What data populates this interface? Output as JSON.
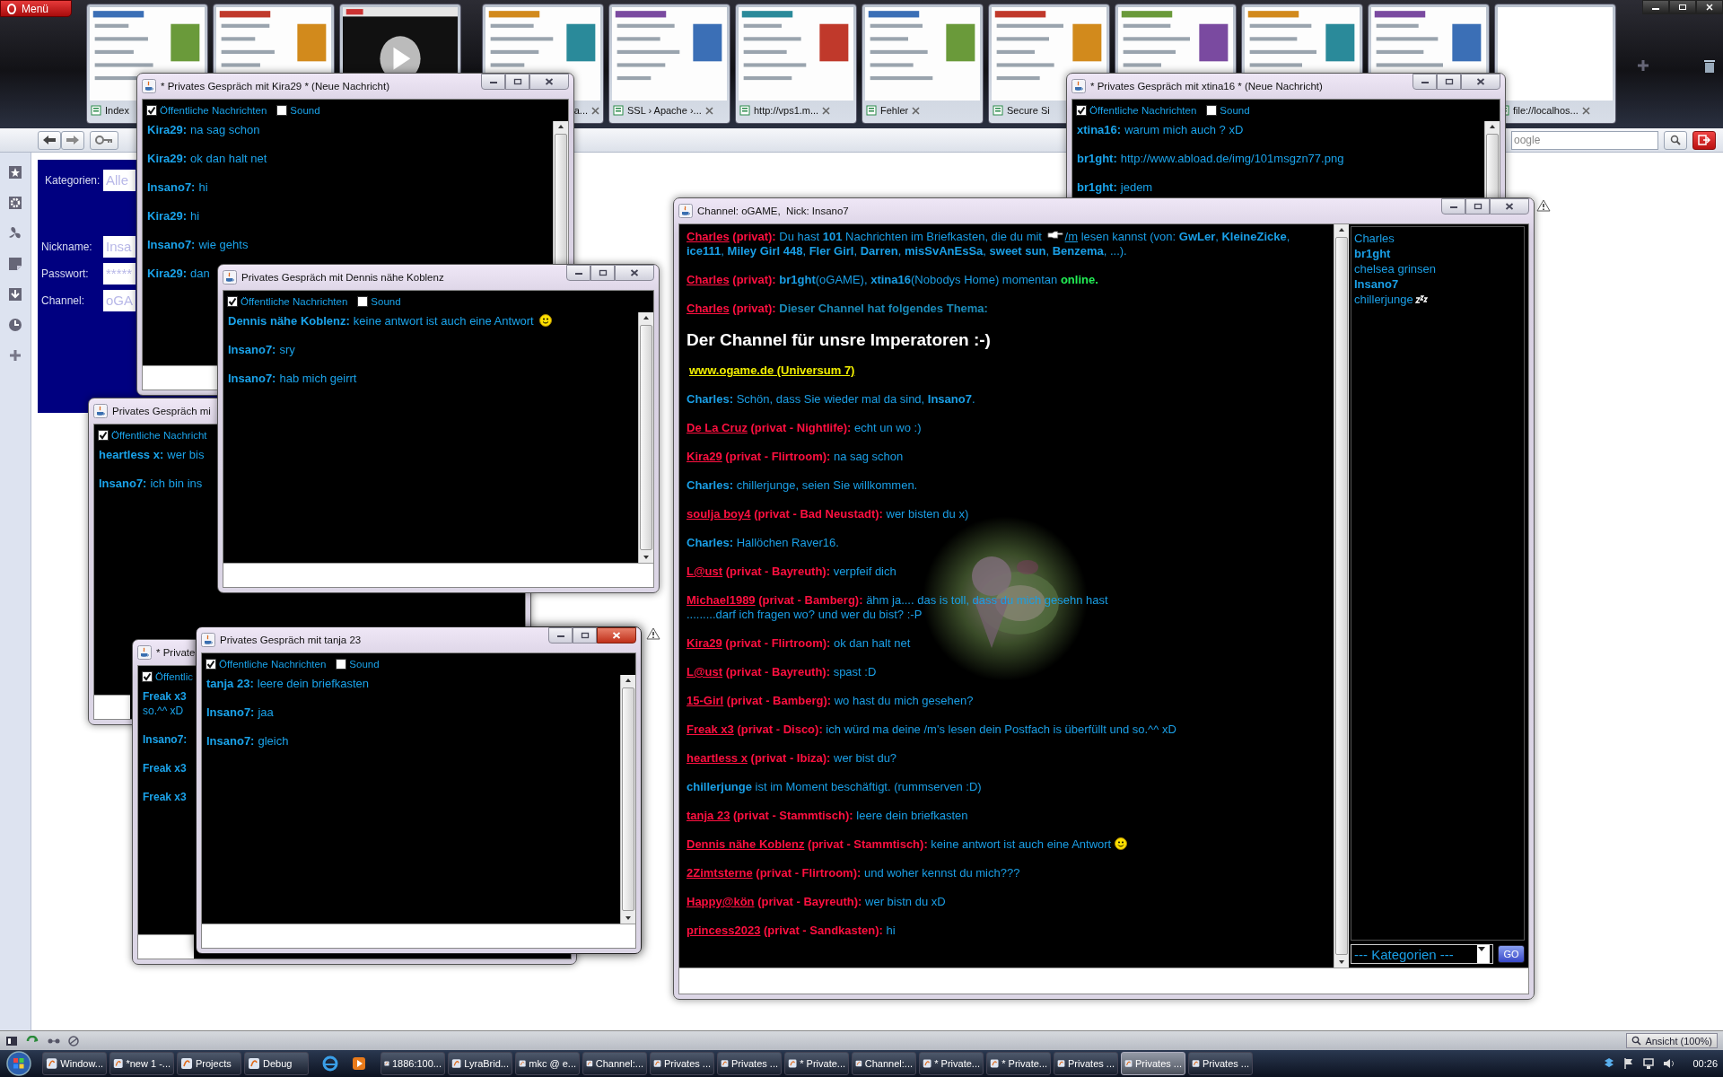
{
  "browser": {
    "menu": "Menü",
    "tabs": [
      {
        "kind": "page",
        "label": "Index",
        "cut": false,
        "close_button": false
      },
      {
        "kind": "page"
      },
      {
        "kind": "video"
      },
      {
        "kind": "page",
        "label": "a...",
        "cut": true,
        "close_button": true
      },
      {
        "kind": "page",
        "label": "SSL › Apache ›...",
        "cut": false,
        "close_button": true
      },
      {
        "kind": "page",
        "label": "http://vps1.m...",
        "cut": false,
        "close_button": true
      },
      {
        "kind": "page",
        "label": "Fehler",
        "cut": false,
        "close_button": true
      },
      {
        "kind": "page",
        "label": "Secure Si",
        "cut": false,
        "close_button": false
      },
      {
        "kind": "page"
      },
      {
        "kind": "page"
      },
      {
        "kind": "page"
      },
      {
        "kind": "blank",
        "label": "file://localhos...",
        "cut": false,
        "close_button": true
      }
    ],
    "search": {
      "placeholder": "oogle"
    }
  },
  "login_panel": {
    "rows": [
      {
        "label": "Kategorien:",
        "value": "Alle"
      },
      {
        "label": "Nickname:",
        "value": "Insa"
      },
      {
        "label": "Passwort:",
        "value": "*****"
      },
      {
        "label": "Channel:",
        "value": "oGA"
      }
    ]
  },
  "windows": [
    {
      "kind": "private",
      "title": "* Privates Gespräch mit Kira29 * (Neue Nachricht)",
      "active": false,
      "covered": false,
      "public_label": "Öffentliche Nachrichten",
      "public_checked": true,
      "sound_label": "Sound",
      "sound_checked": false,
      "messages": [
        {
          "nick": "Kira29:",
          "text": "na sag schon"
        },
        {
          "nick": "Kira29:",
          "text": "ok dan halt net"
        },
        {
          "nick": "Insano7:",
          "text": "hi"
        },
        {
          "nick": "Kira29:",
          "text": "hi"
        },
        {
          "nick": "Insano7:",
          "text": "wie gehts"
        },
        {
          "nick": "Kira29:",
          "text": "dan"
        }
      ]
    },
    {
      "kind": "private",
      "title": "* Privates Gespräch mit xtina16 * (Neue Nachricht)",
      "active": false,
      "covered": false,
      "public_label": "Öffentliche Nachrichten",
      "public_checked": true,
      "sound_label": "Sound",
      "sound_checked": false,
      "messages": [
        {
          "nick": "xtina16:",
          "text": "warum mich auch ? xD"
        },
        {
          "nick": "br1ght:",
          "text": "http://www.abload.de/img/101msgzn77.png"
        },
        {
          "nick": "br1ght:",
          "text": "jedem"
        }
      ]
    },
    {
      "kind": "channel",
      "title": "Channel: oGAME,  Nick: Insano7",
      "active": false,
      "covered": false,
      "messages": [
        {
          "kind": "line",
          "parts": [
            {
              "kind": "nick",
              "text": "Charles"
            },
            {
              "kind": "tag",
              "text": " (privat):"
            },
            {
              "kind": "text",
              "text": " Du hast "
            },
            {
              "kind": "bold",
              "text": "101"
            },
            {
              "kind": "text",
              "text": " Nachrichten im Briefkasten, die du mit "
            },
            {
              "kind": "hand"
            },
            {
              "kind": "command",
              "text": "/m"
            },
            {
              "kind": "text",
              "text": " lesen kannst (von: "
            },
            {
              "kind": "bold",
              "text": "GwLer"
            },
            {
              "kind": "text",
              "text": ", "
            },
            {
              "kind": "bold",
              "text": "KleineZicke"
            },
            {
              "kind": "text",
              "text": ", "
            },
            {
              "kind": "bold",
              "text": "ice111"
            },
            {
              "kind": "text",
              "text": ", "
            },
            {
              "kind": "bold",
              "text": "Miley Girl 448"
            },
            {
              "kind": "text",
              "text": ", "
            },
            {
              "kind": "bold",
              "text": "Fler Girl"
            },
            {
              "kind": "text",
              "text": ", "
            },
            {
              "kind": "bold",
              "text": "Darren"
            },
            {
              "kind": "text",
              "text": ", "
            },
            {
              "kind": "bold",
              "text": "misSvAnEsSa"
            },
            {
              "kind": "text",
              "text": ", "
            },
            {
              "kind": "bold",
              "text": "sweet sun"
            },
            {
              "kind": "text",
              "text": ", "
            },
            {
              "kind": "bold",
              "text": "Benzema"
            },
            {
              "kind": "text",
              "text": ", ...)."
            }
          ]
        },
        {
          "kind": "line",
          "parts": [
            {
              "kind": "nick",
              "text": "Charles"
            },
            {
              "kind": "tag",
              "text": " (privat):"
            },
            {
              "kind": "bold",
              "text": " br1ght"
            },
            {
              "kind": "text",
              "text": "(oGAME), "
            },
            {
              "kind": "bold",
              "text": "xtina16"
            },
            {
              "kind": "text",
              "text": "(Nobodys Home) momentan "
            },
            {
              "kind": "online",
              "text": "online."
            }
          ]
        },
        {
          "kind": "line",
          "parts": [
            {
              "kind": "nick",
              "text": "Charles"
            },
            {
              "kind": "tag",
              "text": " (privat):"
            },
            {
              "kind": "notice",
              "text": " Dieser Channel hat folgendes Thema:"
            }
          ]
        },
        {
          "kind": "topic",
          "text": "Der Channel für unsre Imperatoren :-)"
        },
        {
          "kind": "link",
          "text": "www.ogame.de (Universum 7)"
        },
        {
          "kind": "line",
          "parts": [
            {
              "kind": "bold",
              "text": "Charles:"
            },
            {
              "kind": "text",
              "text": " Schön, dass Sie wieder mal da sind, "
            },
            {
              "kind": "bold",
              "text": "Insano7"
            },
            {
              "kind": "text",
              "text": "."
            }
          ]
        },
        {
          "kind": "line",
          "parts": [
            {
              "kind": "nick",
              "text": "De La Cruz"
            },
            {
              "kind": "tag",
              "text": " (privat - Nightlife):"
            },
            {
              "kind": "text",
              "text": " echt un wo :)"
            }
          ]
        },
        {
          "kind": "line",
          "parts": [
            {
              "kind": "nick",
              "text": "Kira29"
            },
            {
              "kind": "tag",
              "text": " (privat - Flirtroom):"
            },
            {
              "kind": "text",
              "text": " na sag schon"
            }
          ]
        },
        {
          "kind": "line",
          "parts": [
            {
              "kind": "bold",
              "text": "Charles:"
            },
            {
              "kind": "text",
              "text": " chillerjunge, seien Sie willkommen."
            }
          ]
        },
        {
          "kind": "line",
          "parts": [
            {
              "kind": "nick",
              "text": "soulja boy4"
            },
            {
              "kind": "tag",
              "text": " (privat - Bad Neustadt):"
            },
            {
              "kind": "text",
              "text": " wer bisten du x)"
            }
          ]
        },
        {
          "kind": "line",
          "parts": [
            {
              "kind": "bold",
              "text": "Charles:"
            },
            {
              "kind": "text",
              "text": " Hallöchen Raver16."
            }
          ]
        },
        {
          "kind": "line",
          "parts": [
            {
              "kind": "nick",
              "text": "L@ust"
            },
            {
              "kind": "tag",
              "text": " (privat - Bayreuth):"
            },
            {
              "kind": "text",
              "text": " verpfeif dich"
            }
          ]
        },
        {
          "kind": "line",
          "parts": [
            {
              "kind": "nick",
              "text": "Michael1989"
            },
            {
              "kind": "tag",
              "text": " (privat - Bamberg):"
            },
            {
              "kind": "text",
              "text": " ähm ja.... das is toll, dass du mich gesehn hast\n.........darf ich fragen wo? und wer du bist? :-P"
            }
          ]
        },
        {
          "kind": "line",
          "parts": [
            {
              "kind": "nick",
              "text": "Kira29"
            },
            {
              "kind": "tag",
              "text": " (privat - Flirtroom):"
            },
            {
              "kind": "text",
              "text": " ok dan halt net"
            }
          ]
        },
        {
          "kind": "line",
          "parts": [
            {
              "kind": "nick",
              "text": "L@ust"
            },
            {
              "kind": "tag",
              "text": " (privat - Bayreuth):"
            },
            {
              "kind": "text",
              "text": " spast  :D"
            }
          ]
        },
        {
          "kind": "line",
          "parts": [
            {
              "kind": "nick",
              "text": "15-Girl"
            },
            {
              "kind": "tag",
              "text": " (privat - Bamberg):"
            },
            {
              "kind": "text",
              "text": " wo hast du mich gesehen?"
            }
          ]
        },
        {
          "kind": "line",
          "parts": [
            {
              "kind": "nick",
              "text": "Freak x3"
            },
            {
              "kind": "tag",
              "text": " (privat - Disco):"
            },
            {
              "kind": "text",
              "text": " ich würd ma deine /m's lesen dein Postfach is überfüllt und so.^^ xD"
            }
          ]
        },
        {
          "kind": "line",
          "parts": [
            {
              "kind": "nick",
              "text": "heartless x"
            },
            {
              "kind": "tag",
              "text": " (privat - Ibiza):"
            },
            {
              "kind": "text",
              "text": " wer bist du?"
            }
          ]
        },
        {
          "kind": "line",
          "parts": [
            {
              "kind": "bold",
              "text": "chillerjunge"
            },
            {
              "kind": "text",
              "text": " ist im Moment beschäftigt. (rummserven :D)"
            }
          ]
        },
        {
          "kind": "line",
          "parts": [
            {
              "kind": "nick",
              "text": "tanja 23"
            },
            {
              "kind": "tag",
              "text": " (privat - Stammtisch):"
            },
            {
              "kind": "text",
              "text": " leere dein briefkasten"
            }
          ]
        },
        {
          "kind": "line",
          "parts": [
            {
              "kind": "nick",
              "text": "Dennis nähe Koblenz"
            },
            {
              "kind": "tag",
              "text": " (privat - Stammtisch):"
            },
            {
              "kind": "text",
              "text": " keine antwort ist auch eine Antwort "
            },
            {
              "kind": "smiley"
            }
          ]
        },
        {
          "kind": "line",
          "parts": [
            {
              "kind": "nick",
              "text": "2Zimtsterne"
            },
            {
              "kind": "tag",
              "text": " (privat - Flirtroom):"
            },
            {
              "kind": "text",
              "text": " und woher kennst du mich???"
            }
          ]
        },
        {
          "kind": "line",
          "parts": [
            {
              "kind": "nick",
              "text": "Happy@kön"
            },
            {
              "kind": "tag",
              "text": " (privat - Bayreuth):"
            },
            {
              "kind": "text",
              "text": " wer bistn du xD"
            }
          ]
        },
        {
          "kind": "line",
          "parts": [
            {
              "kind": "nick",
              "text": "princess2023"
            },
            {
              "kind": "tag",
              "text": " (privat - Sandkasten):"
            },
            {
              "kind": "text",
              "text": " hi"
            }
          ]
        }
      ],
      "users": [
        {
          "name": "Charles",
          "bold": false,
          "away": false
        },
        {
          "name": "br1ght",
          "bold": true,
          "away": false
        },
        {
          "name": "chelsea grinsen",
          "bold": false,
          "away": false
        },
        {
          "name": "Insano7",
          "bold": true,
          "away": false
        },
        {
          "name": "chillerjunge",
          "bold": false,
          "away": true
        }
      ],
      "category_select": "--- Kategorien ---",
      "go_button": "GO"
    },
    {
      "kind": "private",
      "title": "Privates Gespräch mit Dennis nähe Koblenz",
      "active": false,
      "covered": false,
      "public_label": "Öffentliche Nachrichten",
      "public_checked": true,
      "sound_label": "Sound",
      "sound_checked": false,
      "messages": [
        {
          "nick": "Dennis nähe Koblenz:",
          "text": "keine antwort ist auch eine Antwort",
          "smiley": true
        },
        {
          "nick": "Insano7:",
          "text": "sry"
        },
        {
          "nick": "Insano7:",
          "text": "hab mich geirrt"
        }
      ]
    },
    {
      "kind": "private",
      "title": "Privates Gespräch mi",
      "covered": true,
      "public_label": "Öffentliche Nachricht",
      "public_checked": true,
      "messages": [
        {
          "nick": "heartless x:",
          "text": "wer bis"
        },
        {
          "nick": "Insano7:",
          "text": "ich bin ins"
        }
      ]
    },
    {
      "kind": "private",
      "title": "Privates Gespräch mit tanja 23",
      "active": true,
      "covered": false,
      "public_label": "Öffentliche Nachrichten",
      "public_checked": true,
      "sound_label": "Sound",
      "sound_checked": false,
      "messages": [
        {
          "nick": "tanja 23:",
          "text": "leere dein briefkasten"
        },
        {
          "nick": "Insano7:",
          "text": "jaa"
        },
        {
          "nick": "Insano7:",
          "text": "gleich"
        }
      ]
    },
    {
      "kind": "private",
      "title": "* Private",
      "covered": true,
      "public_label": "Öffentlic",
      "public_checked": true,
      "messages": [
        {
          "nick": "Freak x3",
          "wrap": "so.^^ xD"
        },
        {
          "nick": "Insano7:"
        },
        {
          "nick": "Freak x3"
        },
        {
          "nick": "Freak x3"
        }
      ]
    }
  ],
  "status_bar": {
    "zoom": "Ansicht (100%)"
  },
  "taskbar": {
    "items": [
      {
        "label": "Window...",
        "selected": false
      },
      {
        "label": "*new 1 -...",
        "selected": false
      },
      {
        "label": "Projects",
        "selected": false
      },
      {
        "label": "Debug",
        "selected": false
      },
      {
        "label": "1886:100...",
        "selected": false
      },
      {
        "label": "LyraBrid...",
        "selected": false
      },
      {
        "label": "mkc @ e...",
        "selected": false
      },
      {
        "label": "Channel:...",
        "selected": false
      },
      {
        "label": "Privates ...",
        "selected": false
      },
      {
        "label": "Privates ...",
        "selected": false
      },
      {
        "label": "* Private...",
        "selected": false
      },
      {
        "label": "Channel:...",
        "selected": false
      },
      {
        "label": "* Private...",
        "selected": false
      },
      {
        "label": "* Private...",
        "selected": false
      },
      {
        "label": "Privates ...",
        "selected": false
      },
      {
        "label": "Privates ...",
        "selected": true
      },
      {
        "label": "Privates ...",
        "selected": false
      }
    ],
    "clock": "00:26"
  }
}
